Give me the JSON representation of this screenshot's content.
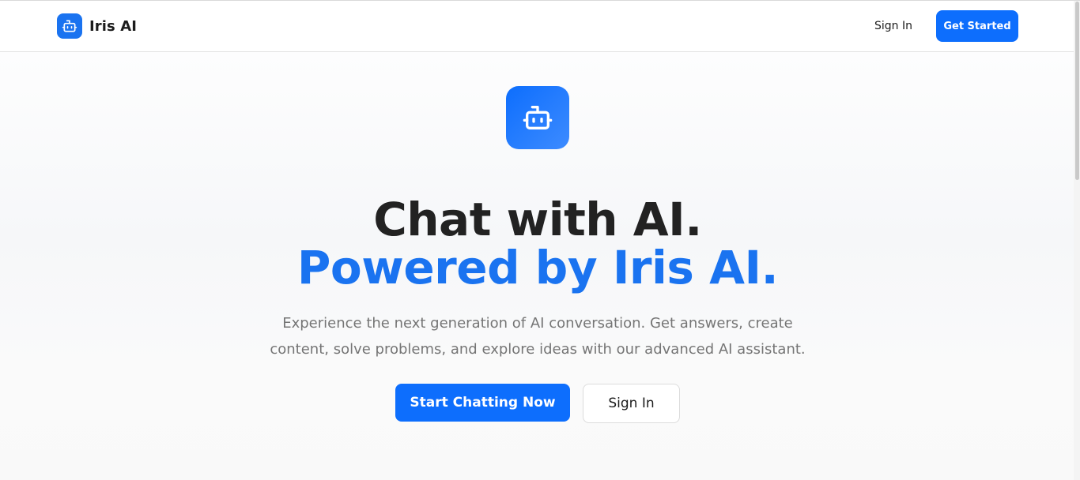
{
  "header": {
    "brand_name": "Iris AI",
    "brand_icon": "robot-icon",
    "sign_in_label": "Sign In",
    "get_started_label": "Get Started"
  },
  "hero": {
    "icon": "robot-icon",
    "title": "Chat with AI.",
    "subtitle": "Powered by Iris AI.",
    "description": "Experience the next generation of AI conversation. Get answers, create content, solve problems, and explore ideas with our advanced AI assistant.",
    "primary_button_label": "Start Chatting Now",
    "secondary_button_label": "Sign In"
  },
  "colors": {
    "accent": "#0d6efd",
    "accent_text": "#1a73f0",
    "heading": "#222222",
    "muted_text": "#757575"
  }
}
